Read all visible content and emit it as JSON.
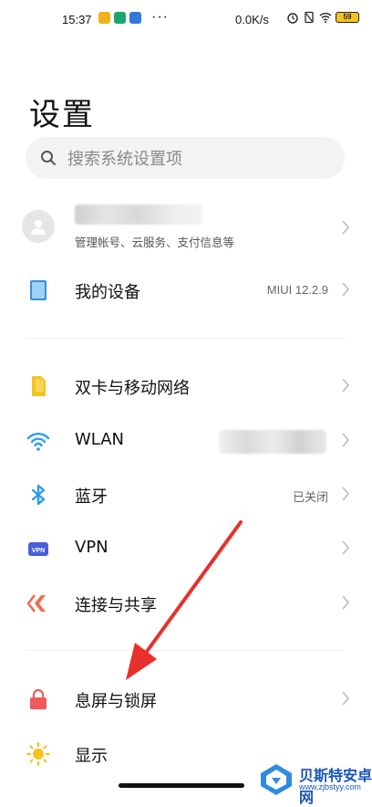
{
  "status_bar": {
    "time": "15:37",
    "dots": "···",
    "speed": "0.0K/s",
    "battery": "59"
  },
  "page_title": "设置",
  "search": {
    "placeholder": "搜索系统设置项"
  },
  "account": {
    "subtitle": "管理帐号、云服务、支付信息等"
  },
  "device": {
    "label": "我的设备",
    "value": "MIUI 12.2.9"
  },
  "items": [
    {
      "label": "双卡与移动网络",
      "value": "",
      "icon": "sim-card-icon",
      "color": "#f5c320"
    },
    {
      "label": "WLAN",
      "value": "",
      "icon": "wifi-icon",
      "color": "#2e9bf0"
    },
    {
      "label": "蓝牙",
      "value": "已关闭",
      "icon": "bluetooth-icon",
      "color": "#2e9bf0"
    },
    {
      "label": "VPN",
      "value": "",
      "icon": "vpn-icon",
      "color": "#4a5ed8"
    },
    {
      "label": "连接与共享",
      "value": "",
      "icon": "share-icon",
      "color": "#f26b4b"
    },
    {
      "label": "息屏与锁屏",
      "value": "",
      "icon": "lock-icon",
      "color": "#f0595a"
    },
    {
      "label": "显示",
      "value": "",
      "icon": "sun-icon",
      "color": "#f5c320"
    }
  ],
  "watermark": {
    "name": "贝斯特安卓网",
    "url": "www.zjbstyy.com"
  },
  "colors": {
    "accent_arrow": "#e8302c",
    "sim": "#f5c320",
    "wifi": "#2e9bf0",
    "device": "#3a8fd8"
  }
}
